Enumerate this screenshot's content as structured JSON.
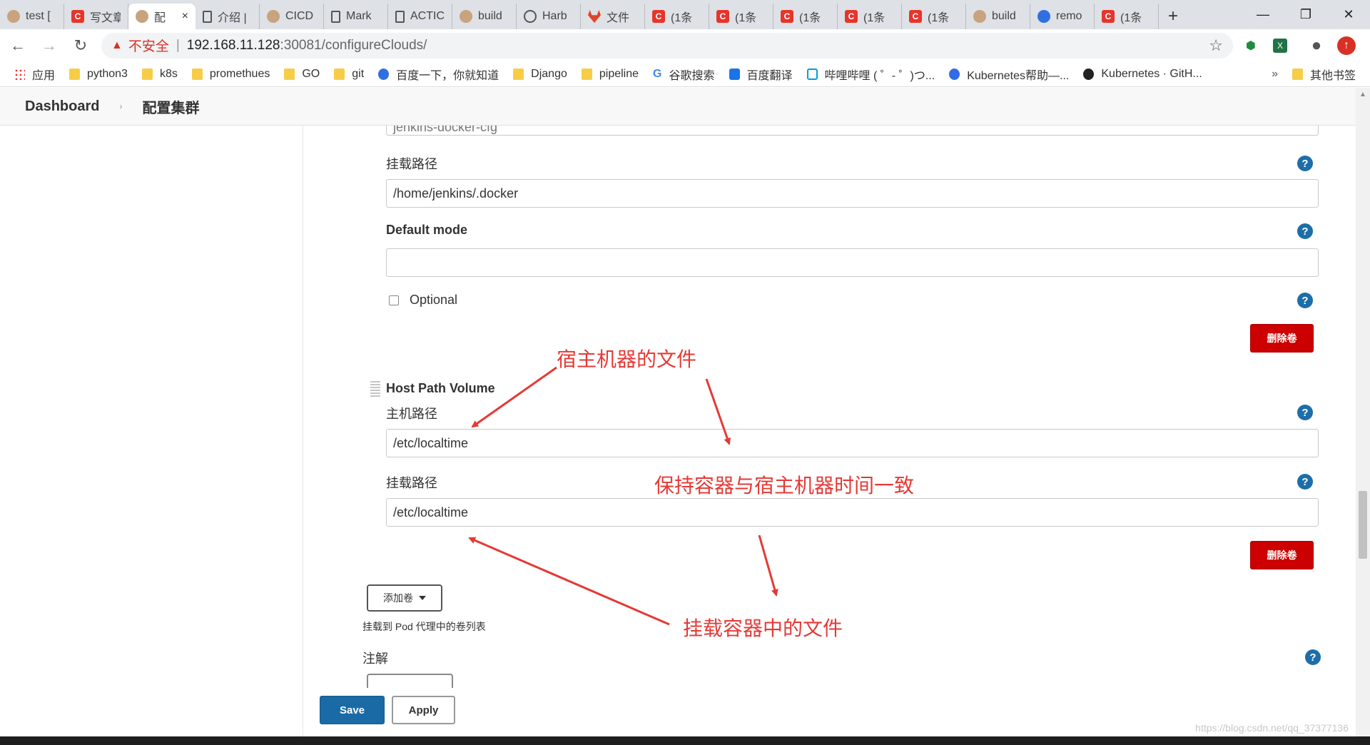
{
  "browser": {
    "tabs": [
      {
        "label": "test [",
        "icon": "jenkins",
        "active": false
      },
      {
        "label": "写文章",
        "icon": "csdn",
        "active": false
      },
      {
        "label": "配",
        "icon": "jenkins",
        "active": true
      },
      {
        "label": "介绍 |",
        "icon": "doc",
        "active": false
      },
      {
        "label": "CICD",
        "icon": "jenkins",
        "active": false
      },
      {
        "label": "Mark",
        "icon": "doc",
        "active": false
      },
      {
        "label": "ACTIC",
        "icon": "doc",
        "active": false
      },
      {
        "label": "build",
        "icon": "jenkins",
        "active": false
      },
      {
        "label": "Harb",
        "icon": "harbor",
        "active": false
      },
      {
        "label": "文件",
        "icon": "gitlab",
        "active": false
      },
      {
        "label": "(1条",
        "icon": "csdn",
        "active": false
      },
      {
        "label": "(1条",
        "icon": "csdn",
        "active": false
      },
      {
        "label": "(1条",
        "icon": "csdn",
        "active": false
      },
      {
        "label": "(1条",
        "icon": "csdn",
        "active": false
      },
      {
        "label": "(1条",
        "icon": "csdn",
        "active": false
      },
      {
        "label": "build",
        "icon": "jenkins",
        "active": false
      },
      {
        "label": "remo",
        "icon": "paw",
        "active": false
      },
      {
        "label": "(1条",
        "icon": "csdn",
        "active": false
      }
    ],
    "active_tab_close": "×",
    "new_tab": "+",
    "window_controls": {
      "minimize": "—",
      "restore": "❐",
      "close": "✕"
    },
    "nav": {
      "back": "←",
      "forward": "→",
      "reload": "↻"
    },
    "address": {
      "warning_icon": "▲",
      "insecure_label": "不安全",
      "separator": "|",
      "host": "192.168.11.128",
      "path": ":30081/configureClouds/"
    },
    "star_icon": "☆",
    "bookmarks": [
      {
        "label": "应用",
        "icon": "apps"
      },
      {
        "label": "python3",
        "icon": "folder"
      },
      {
        "label": "k8s",
        "icon": "folder"
      },
      {
        "label": "promethues",
        "icon": "folder"
      },
      {
        "label": "GO",
        "icon": "folder"
      },
      {
        "label": "git",
        "icon": "folder"
      },
      {
        "label": "百度一下，你就知道",
        "icon": "paw"
      },
      {
        "label": "Django",
        "icon": "folder"
      },
      {
        "label": "pipeline",
        "icon": "folder"
      },
      {
        "label": "谷歌搜索",
        "icon": "google"
      },
      {
        "label": "百度翻译",
        "icon": "trans"
      },
      {
        "label": "哔哩哔哩 ( ゜- ゜)つ...",
        "icon": "tv"
      },
      {
        "label": "Kubernetes帮助—...",
        "icon": "k8s"
      },
      {
        "label": "Kubernetes · GitH...",
        "icon": "gh"
      }
    ],
    "bookmarks_more": "»",
    "other_bookmarks": "其他书签"
  },
  "breadcrumb": {
    "root": "Dashboard",
    "current": "配置集群",
    "separator": "›"
  },
  "form": {
    "partial_top_value": "jenkins-docker-cfg",
    "secret_mount_path_label": "挂载路径",
    "secret_mount_path_value": "/home/jenkins/.docker",
    "default_mode_label": "Default mode",
    "default_mode_value": "",
    "optional_label": "Optional",
    "delete_volume_label": "删除卷",
    "host_path_section": "Host Path Volume",
    "host_path_label": "主机路径",
    "host_path_value": "/etc/localtime",
    "host_mount_path_label": "挂载路径",
    "host_mount_path_value": "/etc/localtime",
    "add_volume_label": "添加卷",
    "add_volume_note": "挂载到 Pod 代理中的卷列表",
    "annotations_label": "注解",
    "help": "?"
  },
  "buttons": {
    "save": "Save",
    "apply": "Apply"
  },
  "annotations": {
    "host_file": "宿主机器的文件",
    "keep_time_sync": "保持容器与宿主机器时间一致",
    "container_file": "挂载容器中的文件"
  },
  "colors": {
    "annotation": "#e53935",
    "delete_button": "#cc0000",
    "save_button": "#1a6aa6",
    "help_icon": "#1d6ea8"
  },
  "watermark": "https://blog.csdn.net/qq_37377136"
}
